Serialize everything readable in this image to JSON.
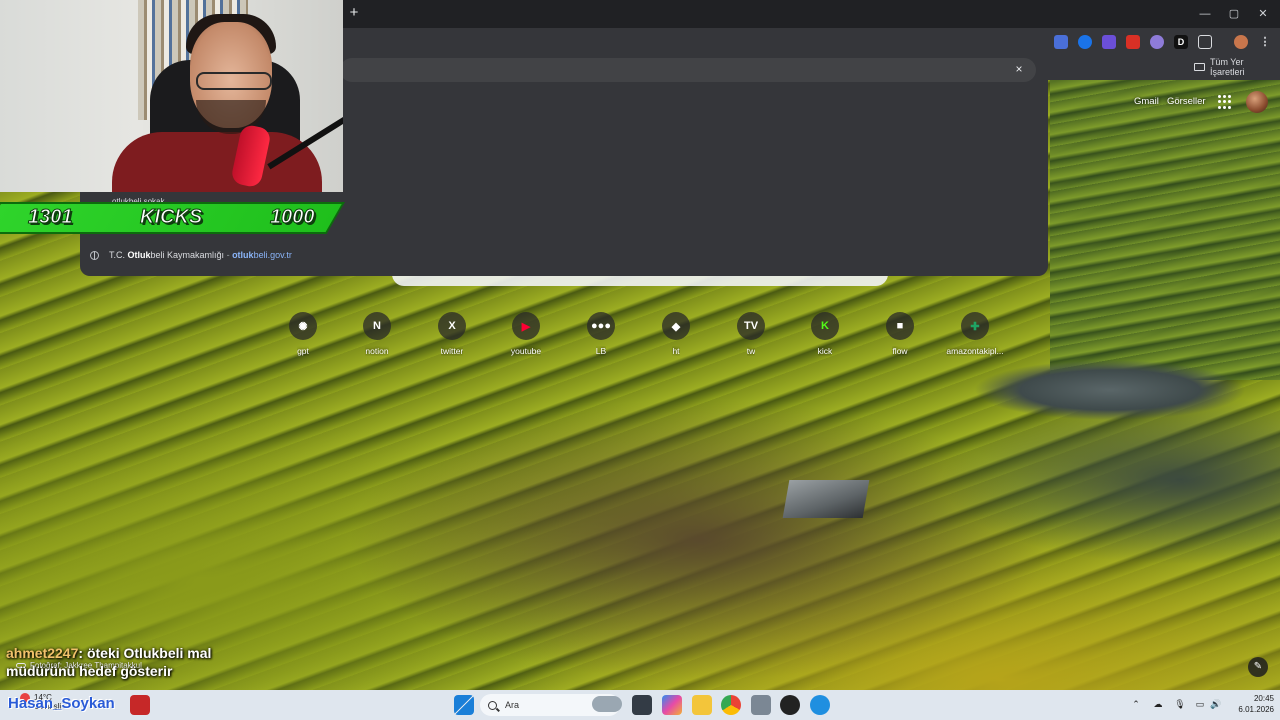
{
  "window": {
    "new_tab": "+",
    "minimize": "—",
    "maximize": "▢",
    "close": "✕"
  },
  "bookmarks": {
    "all_bookmarks_label": "Tüm Yer İşaretleri"
  },
  "omnibox": {
    "clear": "×",
    "suggestion": {
      "title_prefix": "T.C. ",
      "title_bold": "Otluk",
      "title_rest": "beli Kaymakamlığı",
      "separator": " - ",
      "url_bold": "otluk",
      "url_rest": "beli.gov.tr"
    }
  },
  "ntp": {
    "gmail": "Gmail",
    "images": "Görseller",
    "shortcuts": [
      {
        "label": "gpt",
        "icon": "openai-icon",
        "glyph": "✺",
        "color": "#2b2b2b"
      },
      {
        "label": "notion",
        "icon": "notion-icon",
        "glyph": "N",
        "color": "#2b2b2b"
      },
      {
        "label": "twitter",
        "icon": "x-icon",
        "glyph": "X",
        "color": "#111111"
      },
      {
        "label": "youtube",
        "icon": "youtube-icon",
        "glyph": "▶",
        "color": "#ff0033"
      },
      {
        "label": "LB",
        "icon": "letterboxd-icon",
        "glyph": "●●●",
        "color": "#2b2b2b"
      },
      {
        "label": "ht",
        "icon": "ht-icon",
        "glyph": "◆",
        "color": "#2b2b2b"
      },
      {
        "label": "tw",
        "icon": "tradingview-icon",
        "glyph": "TV",
        "color": "#111111"
      },
      {
        "label": "kick",
        "icon": "kick-icon",
        "glyph": "K",
        "color": "#53fc18"
      },
      {
        "label": "flow",
        "icon": "flow-icon",
        "glyph": "■",
        "color": "#2b2b2b"
      },
      {
        "label": "amazontakipl...",
        "icon": "sheets-icon",
        "glyph": "✚",
        "color": "#1fa463"
      }
    ],
    "photo_credit": "Fotoğraf: Jakkree Thampitakkul",
    "edit": "✎"
  },
  "stream": {
    "kick_left": "1301",
    "kick_mid": "KICKS",
    "kick_right": "1000",
    "overflow_text": "otlukbeli sokak",
    "chat_user": "ahmet2247",
    "chat_text_1": ": öteki Otlukbeli mal",
    "chat_text_2": "müdürünü hedef gösterir",
    "streamer_name": "Hasan_Soykan"
  },
  "taskbar": {
    "weather_temp": "14°C",
    "weather_desc": "Güneşli",
    "search_label": "Ara",
    "time": "20:45",
    "date": "6.01.2026"
  },
  "colors": {
    "chrome_dark": "#202124",
    "toolbar": "#35363a",
    "kick_green": "#2fd42b",
    "taskbar": "#dfe6ee"
  }
}
